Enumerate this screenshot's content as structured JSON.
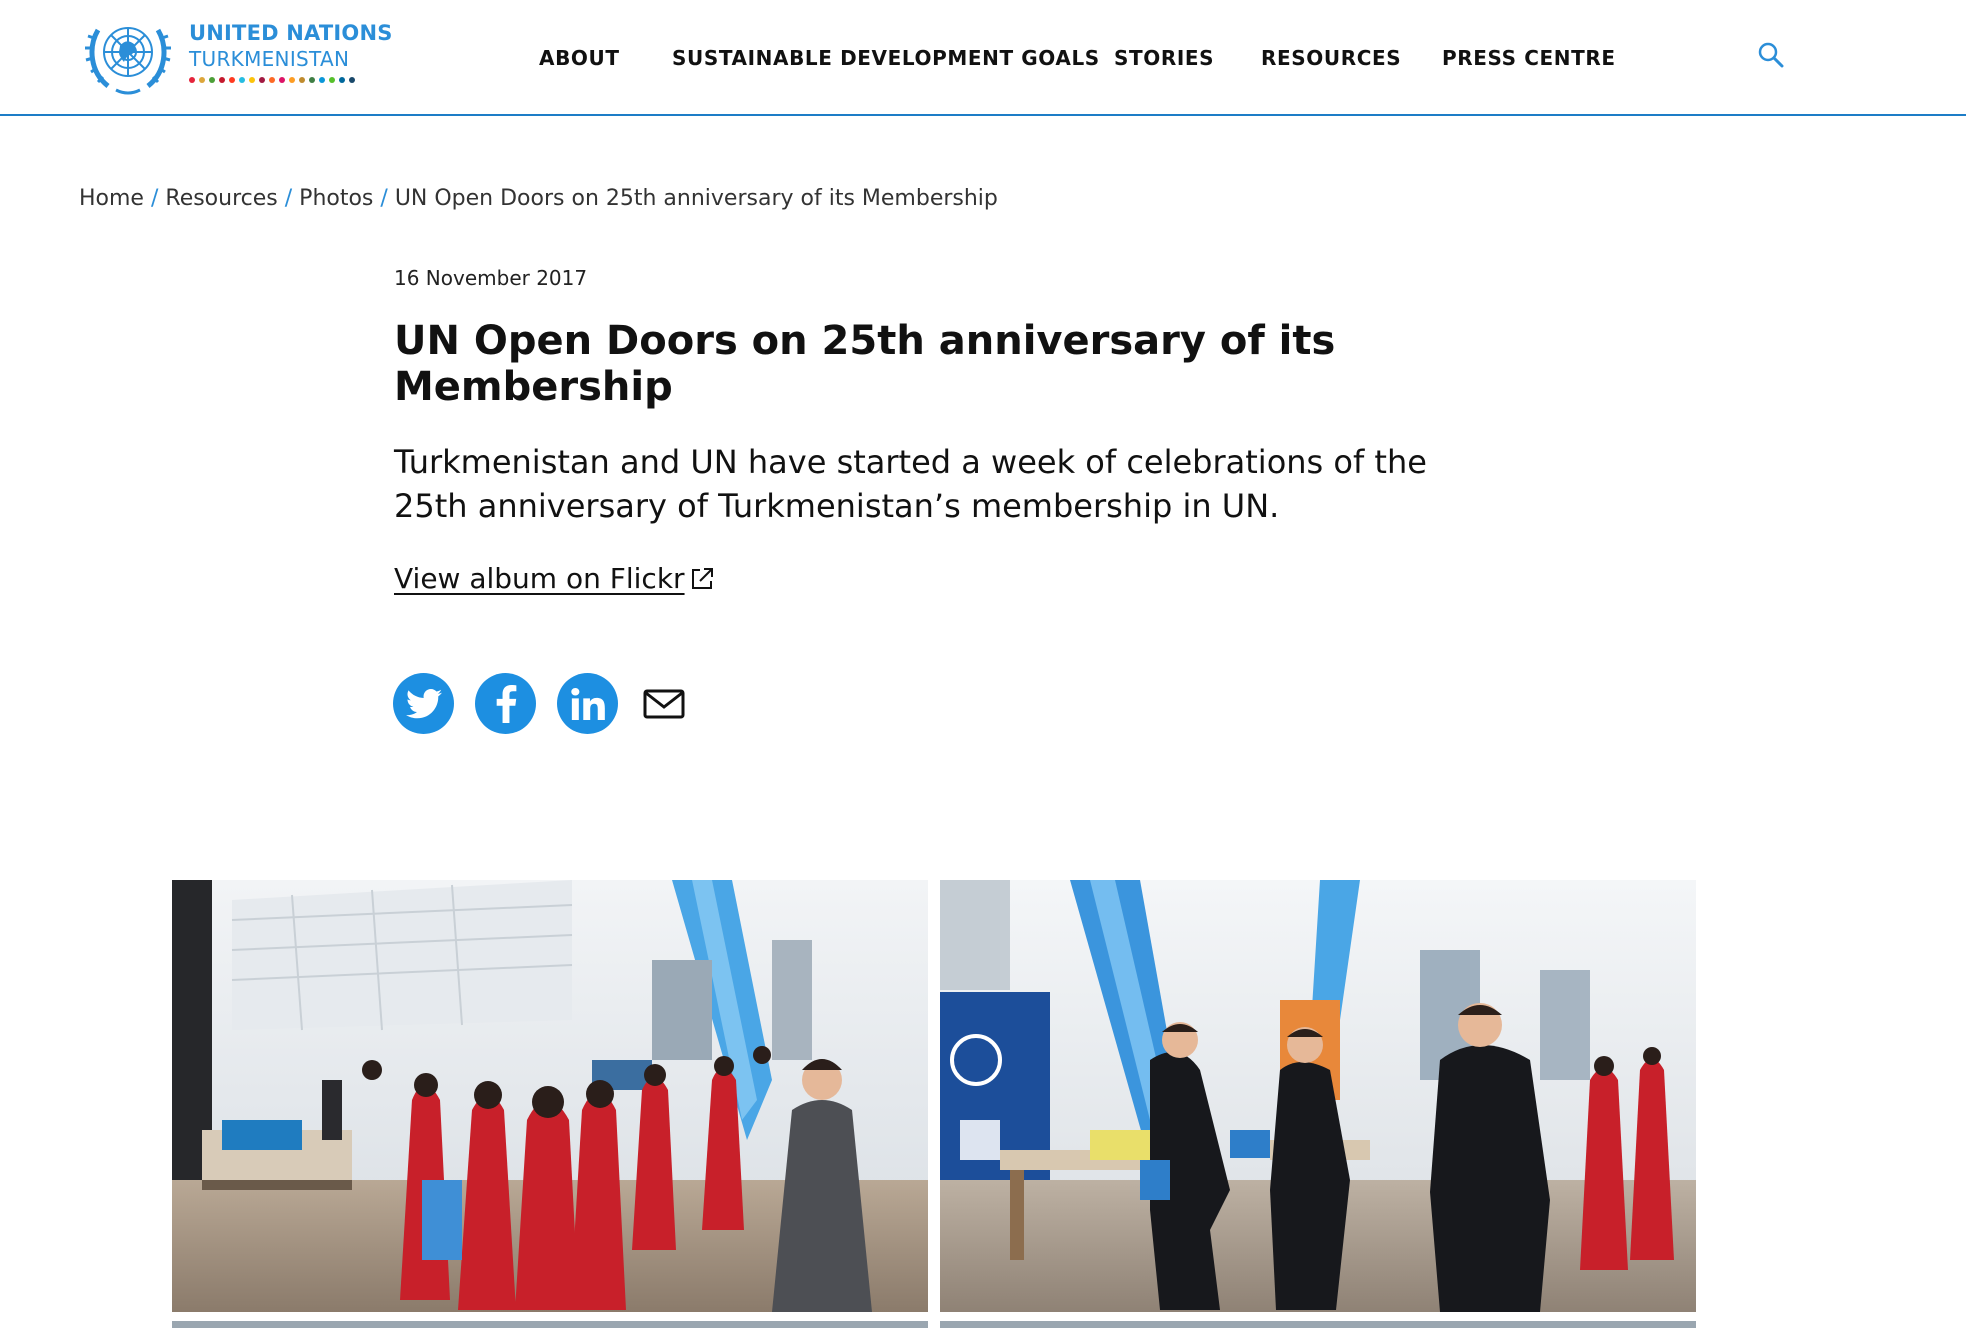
{
  "header": {
    "org_name": "UNITED NATIONS",
    "country": "TURKMENISTAN",
    "brand_color": "#2b8ed8",
    "nav": [
      {
        "label": "ABOUT"
      },
      {
        "label": "SUSTAINABLE DEVELOPMENT GOALS"
      },
      {
        "label": "STORIES"
      },
      {
        "label": "RESOURCES"
      },
      {
        "label": "PRESS CENTRE"
      }
    ],
    "search_icon": "search-icon"
  },
  "breadcrumb": {
    "items": [
      "Home",
      "Resources",
      "Photos"
    ],
    "separator": "/",
    "current": "UN Open Doors on 25th anniversary of its Membership"
  },
  "article": {
    "date": "16 November 2017",
    "title": "UN Open Doors on 25th anniversary of its Membership",
    "lead": "Turkmenistan and UN have started a week of celebrations of the 25th anniversary of Turkmenistan’s membership in UN.",
    "flickr_link": "View album on Flickr",
    "flickr_icon": "external-link-icon"
  },
  "share": {
    "icons": [
      "twitter-icon",
      "facebook-icon",
      "linkedin-icon",
      "mail-icon"
    ],
    "color": "#1d8fe1"
  }
}
